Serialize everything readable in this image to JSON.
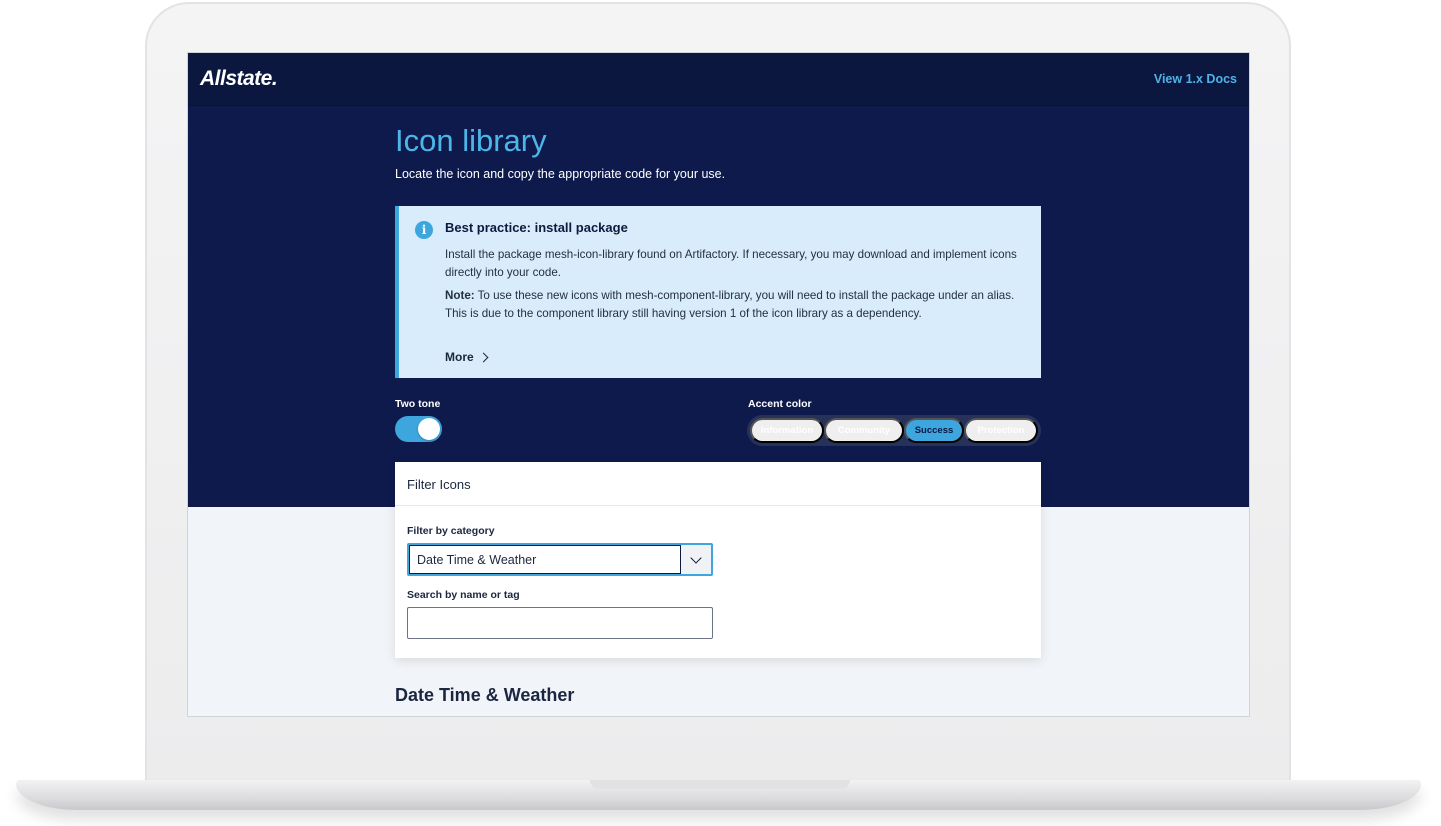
{
  "header": {
    "brand": "Allstate.",
    "docs_link": "View 1.x Docs"
  },
  "page": {
    "title": "Icon library",
    "subtitle": "Locate the icon and copy the appropriate code for your use."
  },
  "callout": {
    "icon": "info-icon",
    "title": "Best practice: install package",
    "body": "Install the package mesh-icon-library found on Artifactory. If necessary, you may download and implement icons directly into your code.",
    "note_label": "Note:",
    "note_text": " To use these new icons with mesh-component-library, you will need to install the package under an alias. This is due to the component library still having version 1 of the icon library as a dependency.",
    "more_label": "More"
  },
  "two_tone": {
    "label": "Two tone",
    "enabled": true
  },
  "accent": {
    "label": "Accent color",
    "options": [
      "Information",
      "Community",
      "Success",
      "Protection"
    ],
    "selected": "Success"
  },
  "filter": {
    "title": "Filter Icons",
    "category_label": "Filter by category",
    "category_value": "Date Time & Weather",
    "search_label": "Search by name or tag",
    "search_value": ""
  },
  "section": {
    "heading": "Date Time & Weather"
  },
  "colors": {
    "navy": "#0e1a4b",
    "accent_blue": "#3ea6de",
    "callout_bg": "#d8ecfb"
  }
}
